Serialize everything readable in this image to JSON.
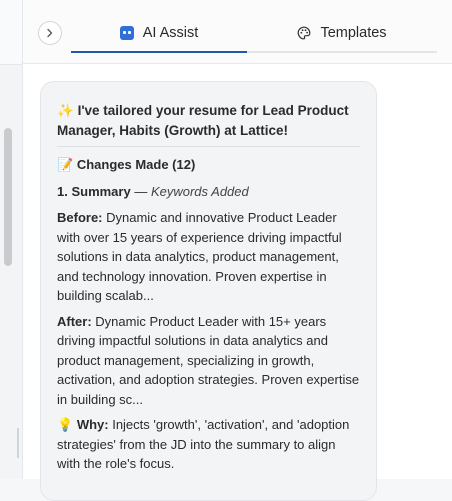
{
  "tabs": [
    {
      "label": "AI Assist",
      "icon": "robot-icon",
      "active": true
    },
    {
      "label": "Templates",
      "icon": "palette-icon",
      "active": false
    }
  ],
  "colors": {
    "accent": "#1f5aa6",
    "robot": "#2f6fd8"
  },
  "message": {
    "title_emoji": "✨",
    "title": "I've tailored your resume for Lead Product Manager, Habits (Growth) at Lattice!",
    "changes_emoji": "📝",
    "changes_label": "Changes Made (12)",
    "change_number": "1. Summary",
    "change_sep": " — ",
    "change_type": "Keywords Added",
    "before_label": "Before:",
    "before_text": " Dynamic and innovative Product Leader with over 15 years of experience driving impactful solutions in data analytics, product management, and technology innovation. Proven expertise in building scalab...",
    "after_label": "After:",
    "after_text": " Dynamic Product Leader with 15+ years driving impactful solutions in data analytics and product management, specializing in growth, activation, and adoption strategies. Proven expertise in building sc...",
    "why_emoji": "💡",
    "why_label": "Why:",
    "why_text": " Injects 'growth', 'activation', and 'adoption strategies' from the JD into the summary to align with the role's focus."
  }
}
